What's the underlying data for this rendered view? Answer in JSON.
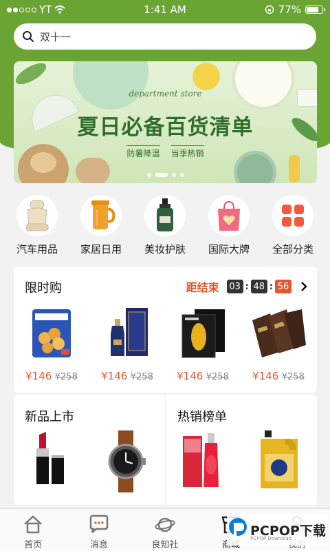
{
  "status_bar": {
    "carrier": "YT",
    "time": "1:41 AM",
    "battery_percent": "77%",
    "battery_level": 0.77
  },
  "search": {
    "query": "双十一"
  },
  "banner": {
    "subtitle_en": "department store",
    "title": "夏日必备百货清单",
    "tags": [
      "防暑降温",
      "当季热销"
    ],
    "slide_count": 4,
    "active_slide": 1
  },
  "categories": [
    {
      "label": "汽车用品",
      "icon": "car-seat-icon"
    },
    {
      "label": "家居日用",
      "icon": "jug-icon"
    },
    {
      "label": "美妆护肤",
      "icon": "skincare-bottle-icon"
    },
    {
      "label": "国际大牌",
      "icon": "gift-bag-icon"
    },
    {
      "label": "全部分类",
      "icon": "all-categories-icon"
    }
  ],
  "flash_sale": {
    "title": "限时购",
    "countdown_label": "距结束",
    "hours": "03",
    "minutes": "48",
    "seconds": "56",
    "products": [
      {
        "name": "snack-bag",
        "price": "¥146",
        "original_price": "¥258"
      },
      {
        "name": "liquor-box",
        "price": "¥146",
        "original_price": "¥258"
      },
      {
        "name": "face-mask-box",
        "price": "¥146",
        "original_price": "¥258"
      },
      {
        "name": "chocolate-bars",
        "price": "¥146",
        "original_price": "¥258"
      }
    ]
  },
  "new_arrivals": {
    "title": "新品上市",
    "items": [
      "lipstick",
      "wristwatch"
    ]
  },
  "best_sellers": {
    "title": "热销榜单",
    "items": [
      "red-serum-box",
      "engine-oil-bottle"
    ]
  },
  "tab_bar": [
    {
      "label": "首页",
      "icon": "home-icon"
    },
    {
      "label": "消息",
      "icon": "message-icon"
    },
    {
      "label": "良知社",
      "icon": "planet-icon"
    },
    {
      "label": "商城",
      "icon": "shop-icon"
    },
    {
      "label": "我的",
      "icon": "profile-icon"
    }
  ],
  "watermark": {
    "text": "PCPOP下载",
    "subtext": "PCPOP Download"
  },
  "colors": {
    "header_green": "#6aa534",
    "accent_red": "#e4572e",
    "banner_title_green": "#2f6d2a"
  }
}
